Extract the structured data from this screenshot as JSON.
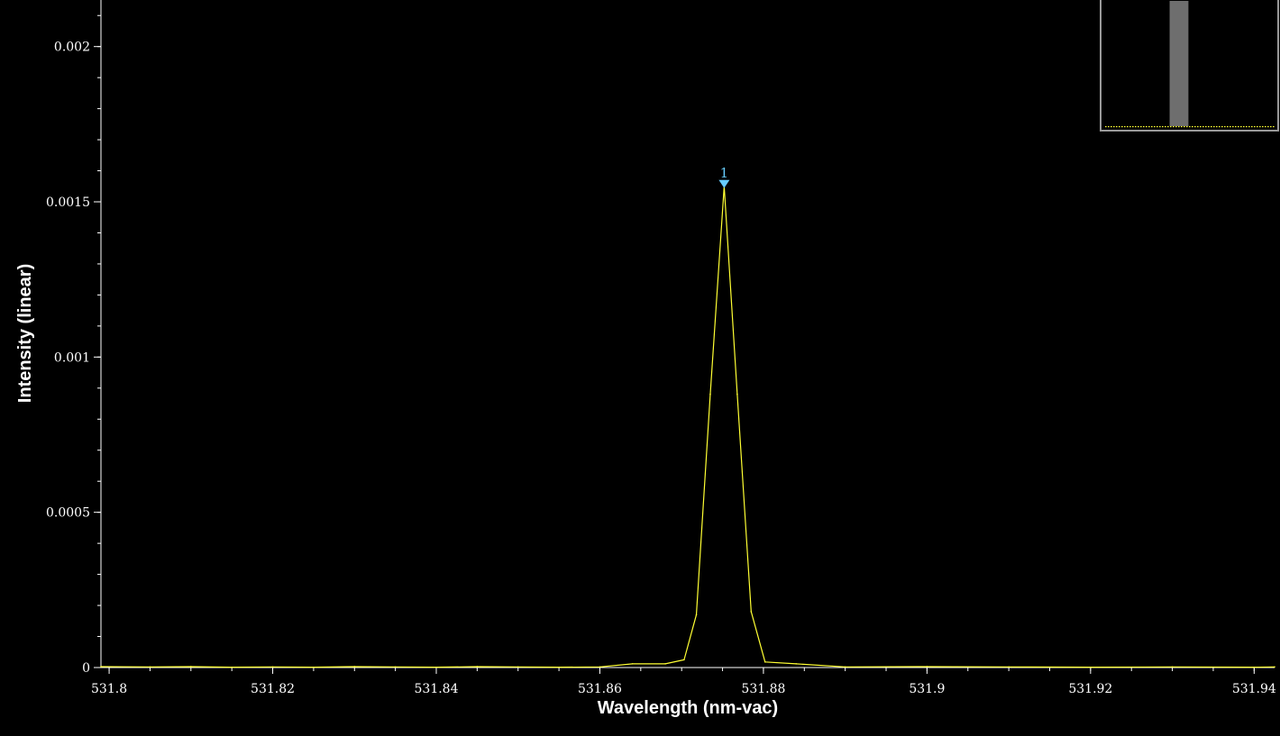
{
  "colors": {
    "background": "#000000",
    "axis": "#ffffff",
    "trace": "#ffff33",
    "peak_marker": "#66ccff",
    "overview_frame": "#9a9a9a",
    "overview_window": "#6e6e6e"
  },
  "chart_data": {
    "type": "line",
    "title": "",
    "xlabel": "Wavelength (nm-vac)",
    "ylabel": "Intensity (linear)",
    "xlim": [
      531.799,
      531.9425
    ],
    "ylim": [
      0,
      0.00215
    ],
    "grid": false,
    "x_ticks": [
      531.8,
      531.82,
      531.84,
      531.86,
      531.88,
      531.9,
      531.92,
      531.94
    ],
    "x_tick_labels": [
      "531.8",
      "531.82",
      "531.84",
      "531.86",
      "531.88",
      "531.9",
      "531.92",
      "531.94"
    ],
    "y_ticks": [
      0,
      0.0005,
      0.001,
      0.0015,
      0.002
    ],
    "y_tick_labels": [
      "0",
      "0.0005",
      "0.001",
      "0.0015",
      "0.002"
    ],
    "series": [
      {
        "x": [
          531.799,
          531.805,
          531.81,
          531.815,
          531.82,
          531.825,
          531.83,
          531.835,
          531.84,
          531.845,
          531.85,
          531.855,
          531.86,
          531.864,
          531.868,
          531.8703,
          531.8718,
          531.8735,
          531.8752,
          531.8768,
          531.8785,
          531.8802,
          531.884,
          531.89,
          531.9,
          531.91,
          531.92,
          531.93,
          531.94,
          531.9425
        ],
        "y": [
          3e-06,
          2e-06,
          3e-06,
          1e-06,
          2e-06,
          1e-06,
          3e-06,
          2e-06,
          1e-06,
          3e-06,
          2e-06,
          1e-06,
          2e-06,
          1.2e-05,
          1.2e-05,
          2.5e-05,
          0.00017,
          0.00088,
          0.00155,
          0.00088,
          0.00018,
          1.8e-05,
          1.2e-05,
          2e-06,
          3e-06,
          2e-06,
          1e-06,
          2e-06,
          1e-06,
          2e-06
        ]
      }
    ],
    "annotations": [
      {
        "label": "1",
        "x": 531.8752,
        "y": 0.00155
      }
    ],
    "overview": {
      "range": [
        531.3,
        532.6
      ],
      "visible_window": [
        531.799,
        531.9425
      ]
    }
  }
}
